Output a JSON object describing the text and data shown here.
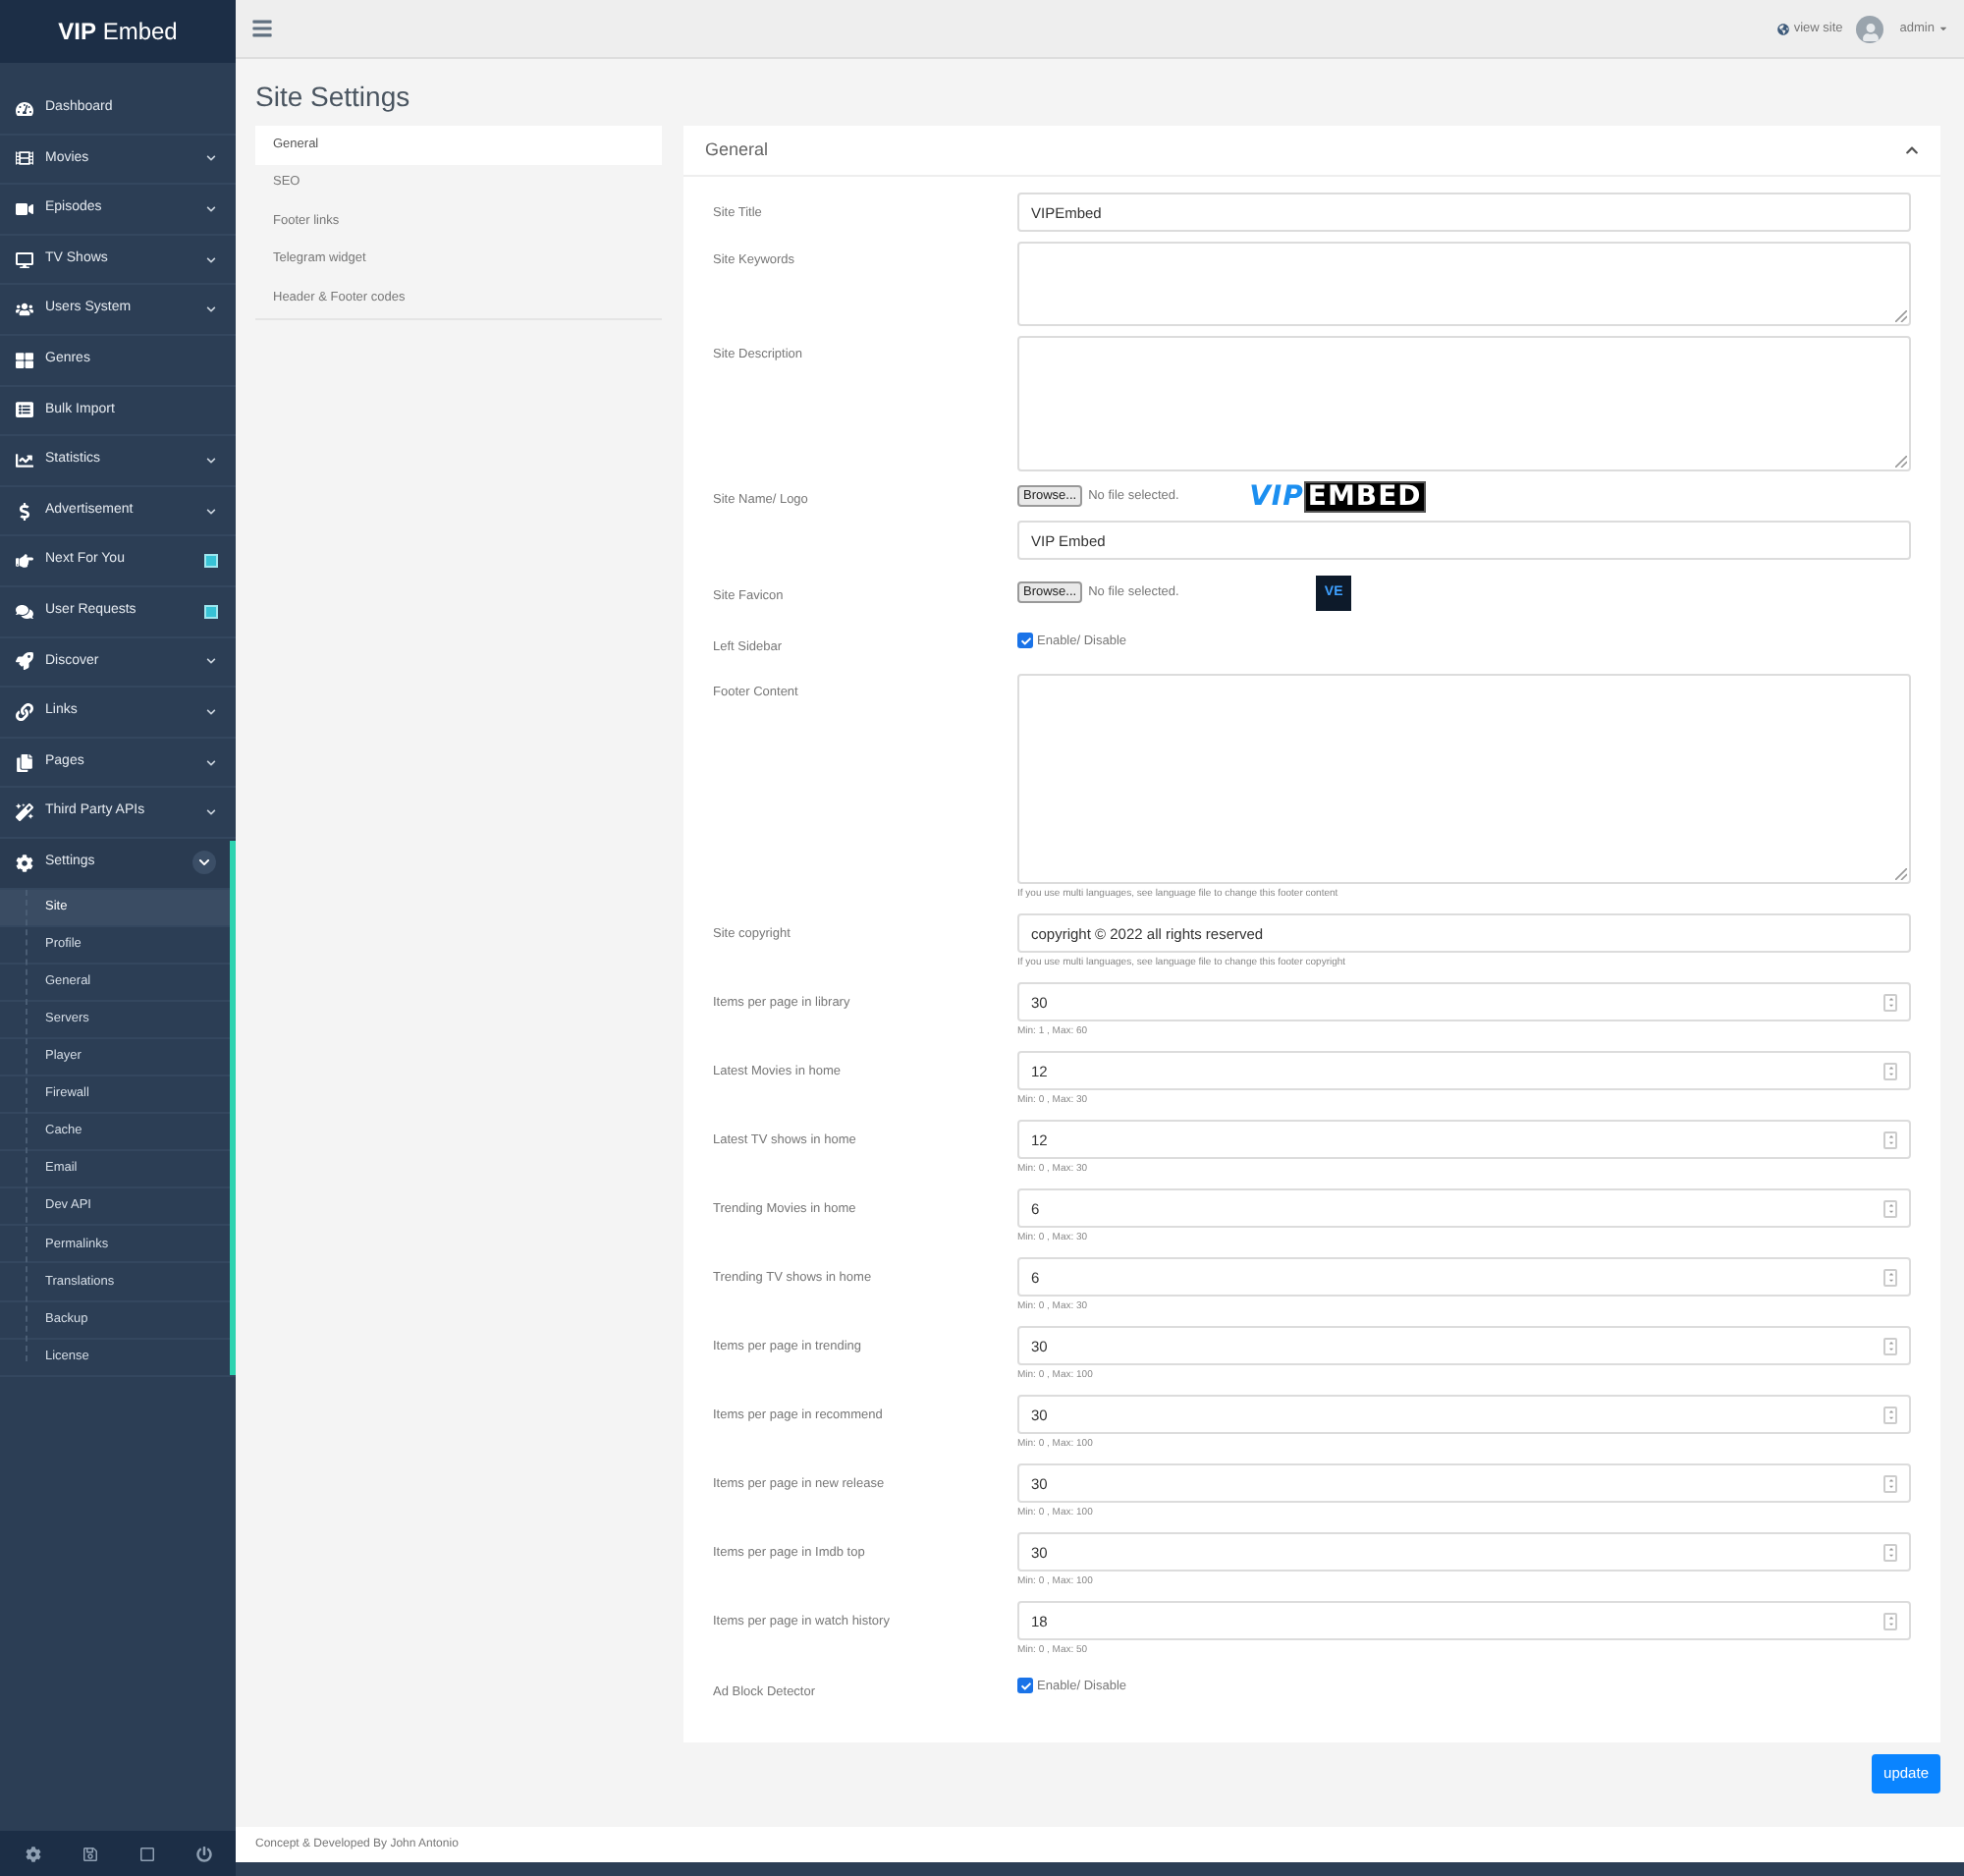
{
  "brand": {
    "bold": "VIP",
    "light": "Embed"
  },
  "sidebar": {
    "items": [
      {
        "label": "Dashboard",
        "submenu": false,
        "badge": false
      },
      {
        "label": "Movies",
        "submenu": true,
        "badge": false,
        "expanded": false
      },
      {
        "label": "Episodes",
        "submenu": true,
        "badge": false,
        "expanded": false
      },
      {
        "label": "TV Shows",
        "submenu": true,
        "badge": false,
        "expanded": false
      },
      {
        "label": "Users System",
        "submenu": true,
        "badge": false,
        "expanded": false
      },
      {
        "label": "Genres",
        "submenu": false,
        "badge": false
      },
      {
        "label": "Bulk Import",
        "submenu": false,
        "badge": false
      },
      {
        "label": "Statistics",
        "submenu": true,
        "badge": false,
        "expanded": false
      },
      {
        "label": "Advertisement",
        "submenu": true,
        "badge": false,
        "expanded": false
      },
      {
        "label": "Next For You",
        "submenu": false,
        "badge": true
      },
      {
        "label": "User Requests",
        "submenu": false,
        "badge": true
      },
      {
        "label": "Discover",
        "submenu": true,
        "badge": false,
        "expanded": false
      },
      {
        "label": "Links",
        "submenu": true,
        "badge": false,
        "expanded": false
      },
      {
        "label": "Pages",
        "submenu": true,
        "badge": false,
        "expanded": false
      },
      {
        "label": "Third Party APIs",
        "submenu": true,
        "badge": false,
        "expanded": false
      },
      {
        "label": "Settings",
        "submenu": true,
        "badge": false,
        "expanded": true,
        "children": [
          {
            "label": "Site",
            "selected": true
          },
          {
            "label": "Profile",
            "selected": false
          },
          {
            "label": "General",
            "selected": false
          },
          {
            "label": "Servers",
            "selected": false
          },
          {
            "label": "Player",
            "selected": false
          },
          {
            "label": "Firewall",
            "selected": false
          },
          {
            "label": "Cache",
            "selected": false
          },
          {
            "label": "Email",
            "selected": false
          },
          {
            "label": "Dev API",
            "selected": false
          },
          {
            "label": "Permalinks",
            "selected": false
          },
          {
            "label": "Translations",
            "selected": false
          },
          {
            "label": "Backup",
            "selected": false
          },
          {
            "label": "License",
            "selected": false
          }
        ]
      }
    ]
  },
  "topbar": {
    "view_site": "view site",
    "user": "admin"
  },
  "page_title": "Site Settings",
  "tabs": [
    {
      "label": "General",
      "selected": true
    },
    {
      "label": "SEO",
      "selected": false
    },
    {
      "label": "Footer links",
      "selected": false
    },
    {
      "label": "Telegram widget",
      "selected": false
    },
    {
      "label": "Header & Footer codes",
      "selected": false
    }
  ],
  "card": {
    "title": "General",
    "expanded": true,
    "fields": [
      {
        "kind": "text",
        "label": "Site Title",
        "value": "VIPEmbed"
      },
      {
        "kind": "textarea",
        "label": "Site Keywords"
      },
      {
        "kind": "textarea",
        "label": "Site Description"
      },
      {
        "kind": "file",
        "label": "Site Name/ Logo",
        "button": "Browse...",
        "status": "No file selected.",
        "preview": {
          "kind": "logo",
          "first": "VIP",
          "second": "EMBED"
        },
        "value": "VIP Embed"
      },
      {
        "kind": "file",
        "label": "Site Favicon",
        "button": "Browse...",
        "status": "No file selected.",
        "preview": {
          "kind": "favicon",
          "first": "VE"
        }
      },
      {
        "kind": "checkbox",
        "label": "Left Sidebar",
        "text": "Enable/ Disable",
        "checked": true
      },
      {
        "kind": "textarea",
        "label": "Footer Content",
        "help": "If you use multi languages, see language file to change this footer content"
      },
      {
        "kind": "text",
        "label": "Site copyright",
        "value": "copyright © 2022 all rights reserved",
        "help": "If you use multi languages, see language file to change this footer copyright"
      },
      {
        "kind": "number",
        "label": "Items per page in library",
        "value": "30",
        "help": "Min: 1 , Max: 60"
      },
      {
        "kind": "number",
        "label": "Latest Movies in home",
        "value": "12",
        "help": "Min: 0 , Max: 30"
      },
      {
        "kind": "number",
        "label": "Latest TV shows in home",
        "value": "12",
        "help": "Min: 0 , Max: 30"
      },
      {
        "kind": "number",
        "label": "Trending Movies in home",
        "value": "6",
        "help": "Min: 0 , Max: 30"
      },
      {
        "kind": "number",
        "label": "Trending TV shows in home",
        "value": "6",
        "help": "Min: 0 , Max: 30"
      },
      {
        "kind": "number",
        "label": "Items per page in trending",
        "value": "30",
        "help": "Min: 0 , Max: 100"
      },
      {
        "kind": "number",
        "label": "Items per page in recommend",
        "value": "30",
        "help": "Min: 0 , Max: 100"
      },
      {
        "kind": "number",
        "label": "Items per page in new release",
        "value": "30",
        "help": "Min: 0 , Max: 100"
      },
      {
        "kind": "number",
        "label": "Items per page in Imdb top",
        "value": "30",
        "help": "Min: 0 , Max: 100"
      },
      {
        "kind": "number",
        "label": "Items per page in watch history",
        "value": "18",
        "help": "Min: 0 , Max: 50"
      },
      {
        "kind": "checkbox",
        "label": "Ad Block Detector",
        "text": "Enable/ Disable",
        "checked": true
      }
    ]
  },
  "update_button": "update",
  "footer": "Concept & Developed By John Antonio"
}
